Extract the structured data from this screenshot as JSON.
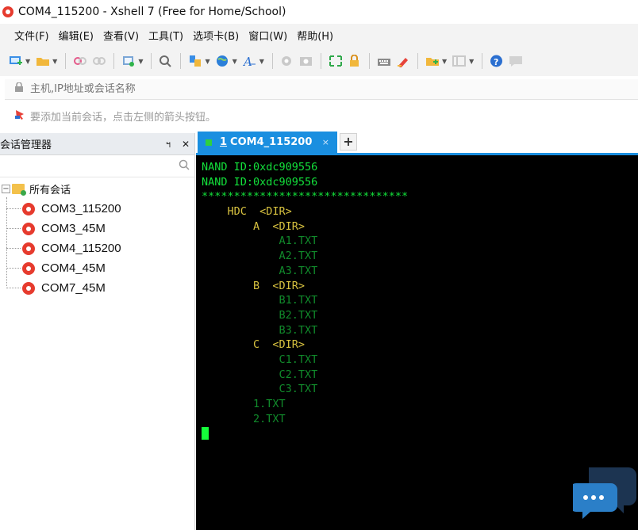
{
  "window": {
    "title": "COM4_115200 - Xshell 7 (Free for Home/School)"
  },
  "menu": [
    "文件(F)",
    "编辑(E)",
    "查看(V)",
    "工具(T)",
    "选项卡(B)",
    "窗口(W)",
    "帮助(H)"
  ],
  "address": {
    "placeholder": "主机,IP地址或会话名称"
  },
  "hint": "要添加当前会话，点击左侧的箭头按钮。",
  "session_manager": {
    "title": "会话管理器",
    "pin": "ฯ",
    "close": "✕",
    "root": "所有会话",
    "sessions": [
      "COM3_115200",
      "COM3_45M",
      "COM4_115200",
      "COM4_45M",
      "COM7_45M"
    ]
  },
  "tab": {
    "index": "1",
    "label": "COM4_115200",
    "close": "×",
    "add": "+"
  },
  "terminal": {
    "lines": [
      {
        "text": "NAND ID:0xdc909556",
        "color": "green"
      },
      {
        "text": "NAND ID:0xdc909556",
        "color": "green"
      },
      {
        "text": "********************************",
        "color": "green"
      },
      {
        "text": "    HDC  <DIR>",
        "color": "yellow"
      },
      {
        "text": "        A  <DIR>",
        "color": "yellow"
      },
      {
        "text": "            A1.TXT",
        "color": "dimgreen"
      },
      {
        "text": "            A2.TXT",
        "color": "dimgreen"
      },
      {
        "text": "            A3.TXT",
        "color": "dimgreen"
      },
      {
        "text": "        B  <DIR>",
        "color": "yellow"
      },
      {
        "text": "            B1.TXT",
        "color": "dimgreen"
      },
      {
        "text": "            B2.TXT",
        "color": "dimgreen"
      },
      {
        "text": "            B3.TXT",
        "color": "dimgreen"
      },
      {
        "text": "        C  <DIR>",
        "color": "yellow"
      },
      {
        "text": "            C1.TXT",
        "color": "dimgreen"
      },
      {
        "text": "            C2.TXT",
        "color": "dimgreen"
      },
      {
        "text": "            C3.TXT",
        "color": "dimgreen"
      },
      {
        "text": "        1.TXT",
        "color": "dimgreen"
      },
      {
        "text": "        2.TXT",
        "color": "dimgreen"
      }
    ]
  },
  "colors": {
    "accent": "#1a8fe0",
    "terminal_bg": "#000000",
    "terminal_green": "#13e13b",
    "terminal_yellow": "#d8c240",
    "terminal_dimgreen": "#118a2b"
  }
}
